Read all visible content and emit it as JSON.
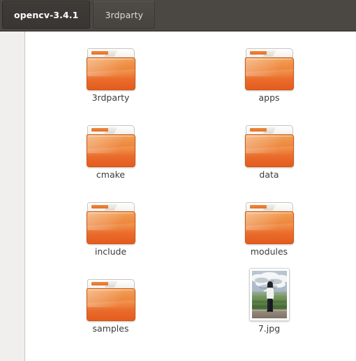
{
  "window": {
    "app": "file-manager",
    "background_color": "#ffffff"
  },
  "pathbar": {
    "background_color": "#4b4843",
    "buttons": [
      {
        "label": "opencv-3.4.1",
        "state": "active"
      },
      {
        "label": "3rdparty",
        "state": "inactive"
      }
    ]
  },
  "sidebar": {
    "background_color": "#f0efee",
    "items": []
  },
  "content": {
    "view": "icon-grid",
    "columns": 2,
    "items": [
      {
        "name": "3rdparty",
        "type": "folder"
      },
      {
        "name": "apps",
        "type": "folder"
      },
      {
        "name": "cmake",
        "type": "folder"
      },
      {
        "name": "data",
        "type": "folder"
      },
      {
        "name": "include",
        "type": "folder"
      },
      {
        "name": "modules",
        "type": "folder"
      },
      {
        "name": "samples",
        "type": "folder"
      },
      {
        "name": "7.jpg",
        "type": "image"
      }
    ]
  },
  "colors": {
    "folder_orange_light": "#f2a258",
    "folder_orange_dark": "#e35c1e",
    "folder_tab_white": "#ffffff",
    "label_text": "#3b3b3b",
    "pathbar_active_text": "#ffffff",
    "pathbar_inactive_text": "#dcdad7"
  }
}
